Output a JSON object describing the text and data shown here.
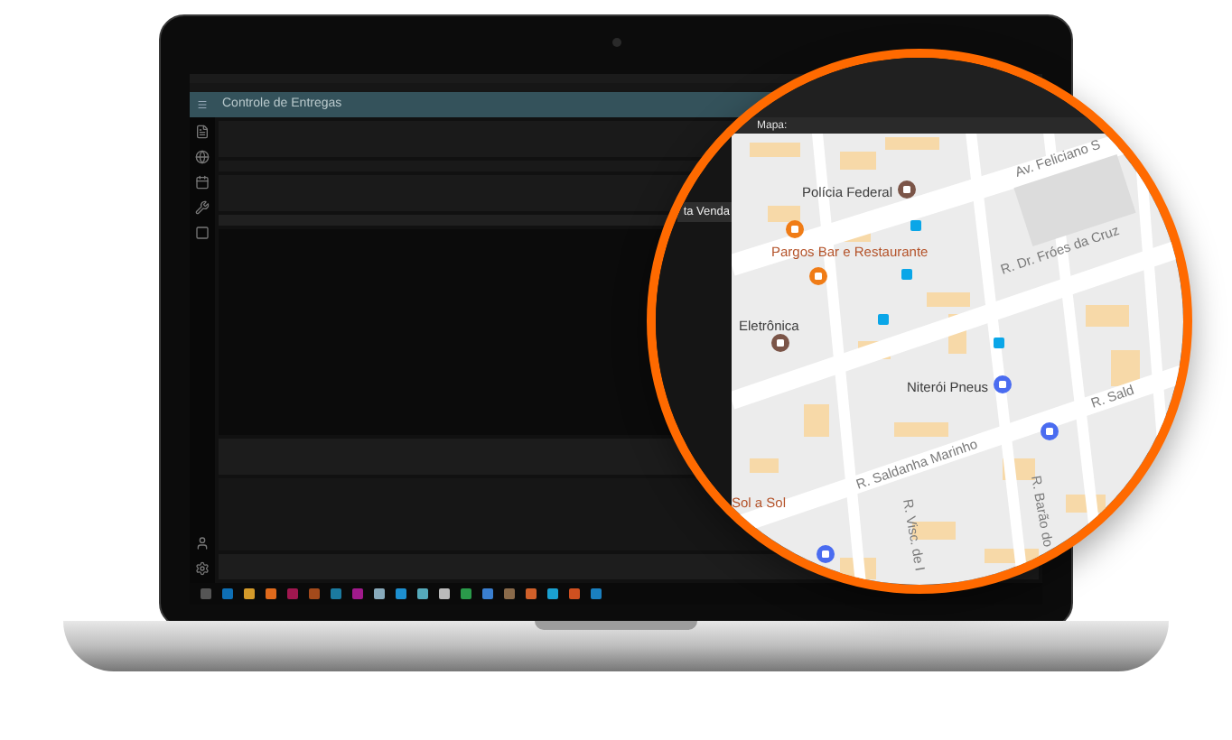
{
  "window": {
    "title": "Controle de Entregas"
  },
  "side_panel": {
    "tab": "ta Venda"
  },
  "map": {
    "title": "Mapa:",
    "labels": [
      {
        "text": "Polícia Federal",
        "kind": "place"
      },
      {
        "text": "Av. Feliciano S",
        "kind": "street"
      },
      {
        "text": "Pargos Bar e Restaurante",
        "kind": "food"
      },
      {
        "text": "R. Dr. Fróes da Cruz",
        "kind": "street"
      },
      {
        "text": "Eletrônica",
        "kind": "place"
      },
      {
        "text": "Niterói Pneus",
        "kind": "place"
      },
      {
        "text": "R. Sald",
        "kind": "street"
      },
      {
        "text": "R. Saldanha Marinho",
        "kind": "street"
      },
      {
        "text": "R. Visc. de I",
        "kind": "street_v"
      },
      {
        "text": "R. Barão do",
        "kind": "street_v"
      },
      {
        "text": "Sol a Sol",
        "kind": "food"
      }
    ]
  }
}
